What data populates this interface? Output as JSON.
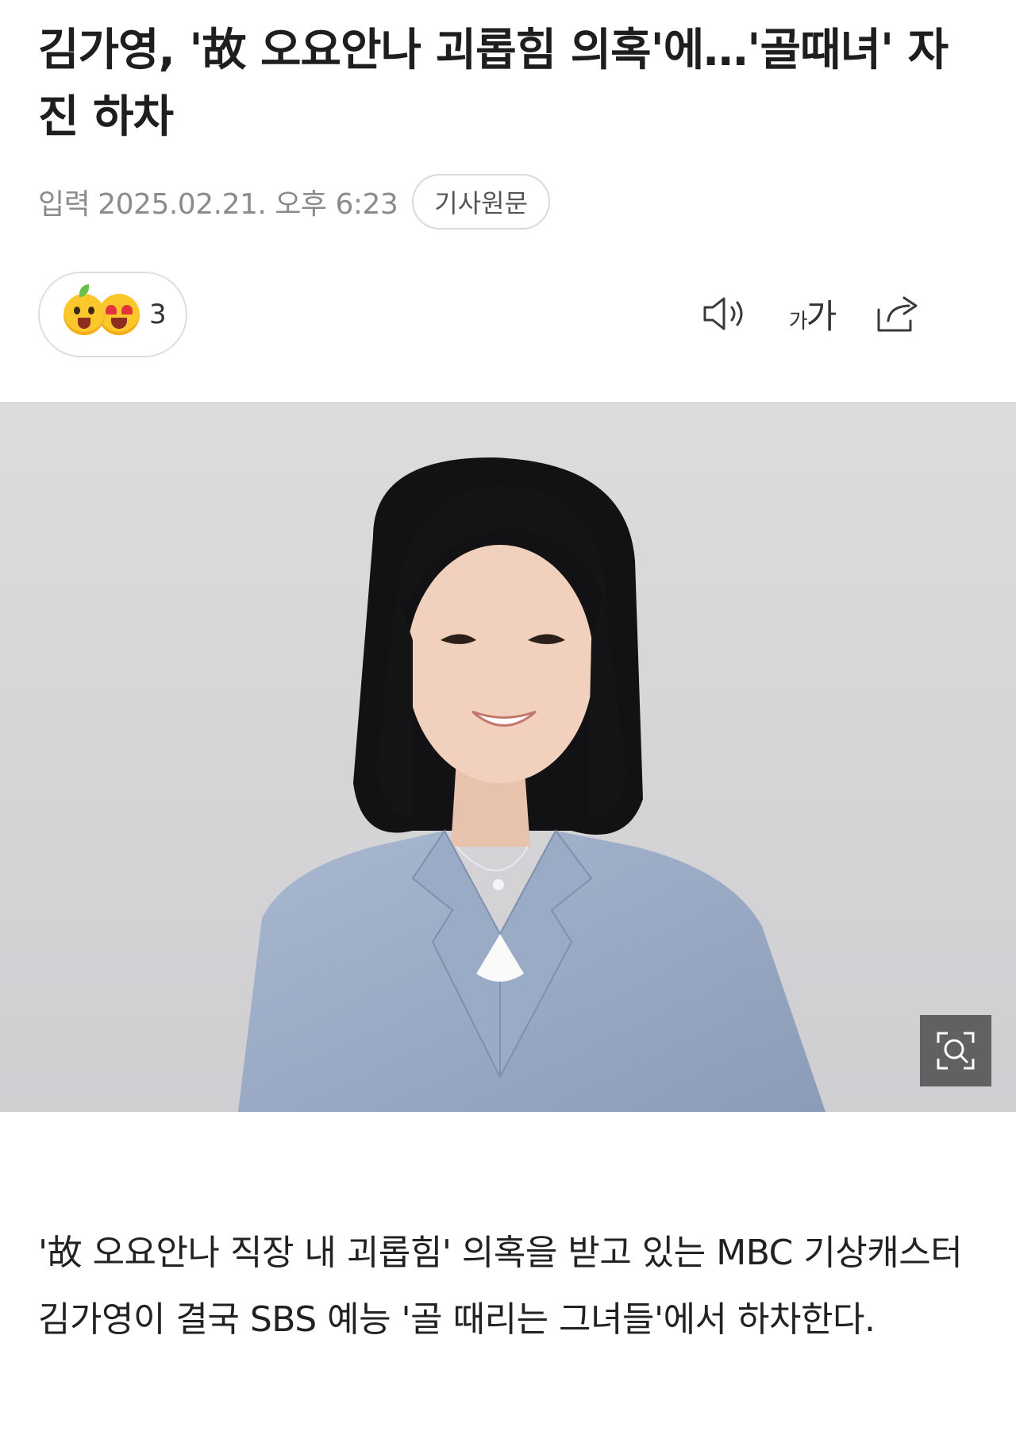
{
  "article": {
    "headline": "김가영, '故 오요안나 괴롭힘 의혹'에…'골때녀' 자진 하차",
    "meta": {
      "input_label": "입력",
      "datetime": "2025.02.21. 오후 6:23",
      "original_button": "기사원문"
    },
    "reactions": {
      "count": "3",
      "emojis": [
        "surprised-emoji",
        "heart-eyes-emoji"
      ]
    },
    "toolbar": {
      "tts_icon": "speaker-icon",
      "font_size_small": "가",
      "font_size_large": "가",
      "share_icon": "share-icon"
    },
    "photo": {
      "zoom_icon": "zoom-search-icon"
    },
    "body": "'故 오요안나 직장 내 괴롭힘' 의혹을 받고 있는 MBC 기상캐스터 김가영이 결국 SBS 예능 '골 때리는 그녀들'에서 하차한다."
  }
}
